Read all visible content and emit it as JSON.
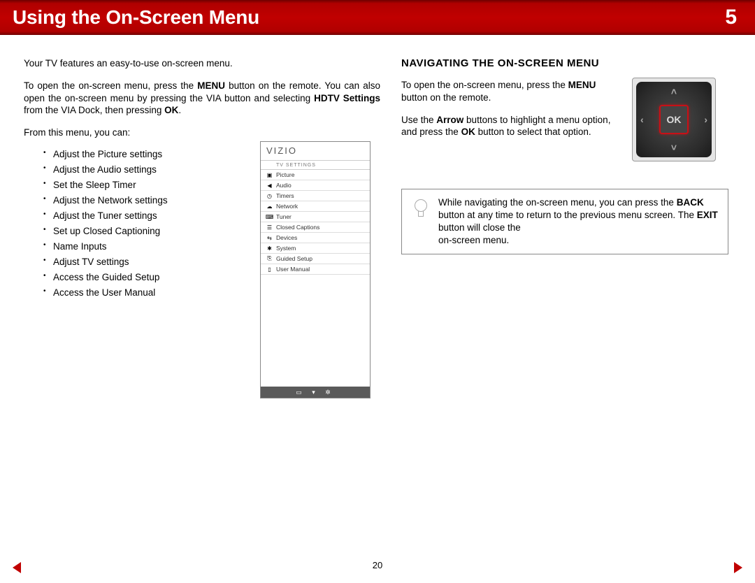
{
  "header": {
    "title": "Using the On-Screen Menu",
    "chapter": "5"
  },
  "left": {
    "intro": "Your TV features an easy-to-use on-screen menu.",
    "open_menu_html": "To open the on-screen menu, press the MENU button on the remote. You can also open the on-screen menu by pressing the VIA button and selecting HDTV Settings from the VIA Dock, then pressing OK.",
    "open_menu_pre": "To open the on-screen menu, press the ",
    "open_menu_b1": "MENU",
    "open_menu_mid1": " button on the remote. You can also open the on-screen menu by pressing the VIA button and selecting ",
    "open_menu_b2": "HDTV Settings",
    "open_menu_mid2": " from the VIA Dock, then pressing ",
    "open_menu_b3": "OK",
    "open_menu_end": ".",
    "from_menu": "From this menu, you can:",
    "bullets": [
      "Adjust the Picture settings",
      "Adjust the Audio settings",
      "Set the Sleep Timer",
      "Adjust the Network settings",
      "Adjust the Tuner settings",
      "Set up Closed Captioning",
      "Name Inputs",
      "Adjust TV settings",
      "Access the Guided Setup",
      "Access the User Manual"
    ]
  },
  "tv_menu": {
    "brand": "VIZIO",
    "subtitle": "TV SETTINGS",
    "items": [
      {
        "icon": "▣",
        "label": "Picture"
      },
      {
        "icon": "◀",
        "label": "Audio"
      },
      {
        "icon": "◷",
        "label": "Timers"
      },
      {
        "icon": "☁",
        "label": "Network"
      },
      {
        "icon": "⌨",
        "label": "Tuner"
      },
      {
        "icon": "☰",
        "label": "Closed Captions"
      },
      {
        "icon": "⇆",
        "label": "Devices"
      },
      {
        "icon": "✱",
        "label": "System"
      },
      {
        "icon": "⎘",
        "label": "Guided Setup"
      },
      {
        "icon": "▯",
        "label": "User Manual"
      }
    ],
    "footer": "▭ ▾ ✲"
  },
  "right": {
    "heading": "NAVIGATING THE ON-SCREEN MENU",
    "p1_pre": "To open the on-screen menu, press the ",
    "p1_b": "MENU",
    "p1_post": " button on the remote.",
    "p2_pre": "Use the ",
    "p2_b1": "Arrow",
    "p2_mid": " buttons to highlight a menu option, and press the ",
    "p2_b2": "OK",
    "p2_post": " button to select that option."
  },
  "remote": {
    "ok": "OK"
  },
  "tip": {
    "pre": "While navigating the on-screen menu, you can press the ",
    "b1": "BACK",
    "mid1": " button at any time to return to the previous menu screen. The ",
    "b2": "EXIT",
    "mid2": " button will close the ",
    "end": "on-screen menu."
  },
  "page_number": "20"
}
